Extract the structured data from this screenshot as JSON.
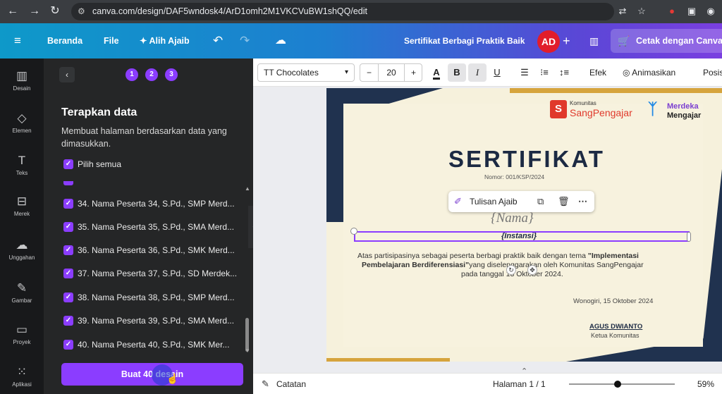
{
  "browser": {
    "url": "canva.com/design/DAF5wndosk4/ArD1omh2M1VKCVuBW1shQQ/edit"
  },
  "topbar": {
    "menu_icon": "hamburger-icon",
    "home": "Beranda",
    "file": "File",
    "magic": "Alih Ajaib",
    "title": "Sertifikat Berbagi Praktik Baik",
    "avatar": "AD",
    "print": "Cetak dengan Canva"
  },
  "rail": {
    "items": [
      {
        "label": "Desain",
        "icon": "layout-icon"
      },
      {
        "label": "Elemen",
        "icon": "shapes-icon"
      },
      {
        "label": "Teks",
        "icon": "text-icon"
      },
      {
        "label": "Merek",
        "icon": "brand-icon"
      },
      {
        "label": "Unggahan",
        "icon": "upload-icon"
      },
      {
        "label": "Gambar",
        "icon": "draw-icon"
      },
      {
        "label": "Proyek",
        "icon": "folder-icon"
      },
      {
        "label": "Aplikasi",
        "icon": "apps-icon"
      }
    ]
  },
  "panel": {
    "steps": [
      "1",
      "2",
      "3"
    ],
    "title": "Terapkan data",
    "description": "Membuat halaman berdasarkan data yang dimasukkan.",
    "select_all": "Pilih semua",
    "rows": [
      "34. Nama Peserta 34, S.Pd., SMP Merd...",
      "35. Nama Peserta 35, S.Pd., SMA Merd...",
      "36. Nama Peserta 36, S.Pd., SMK Merd...",
      "37. Nama Peserta 37, S.Pd., SD Merdek...",
      "38. Nama Peserta 38, S.Pd., SMP Merd...",
      "39. Nama Peserta 39, S.Pd., SMA Merd...",
      "40. Nama Peserta 40, S.Pd., SMK Mer..."
    ],
    "create_button": "Buat 40 desain"
  },
  "toolbar": {
    "font": "TT Chocolates",
    "font_size": "20",
    "minus": "−",
    "plus": "+",
    "bold": "B",
    "italic": "I",
    "underline": "U",
    "effects": "Efek",
    "animate": "Animasikan",
    "position": "Posisi"
  },
  "certificate": {
    "community_small": "Komunitas",
    "community_big": "SangPengajar",
    "merdeka1": "Merdeka",
    "merdeka2": "Mengajar",
    "heading": "SERTIFIKAT",
    "number": "Nomor: 001/KSP/2024",
    "name_placeholder": "{Nama}",
    "institution_placeholder": "{Instansi}",
    "body_line1_pre": "Atas partisipasinya sebagai peserta berbagi praktik baik dengan tema ",
    "body_line1_bold": "\"Implementasi",
    "body_line2_bold": "Pembelajaran Berdiferensiasi\"",
    "body_line2_post": "yang diselenggarakan oleh Komunitas SangPengajar",
    "body_line3": "pada tanggal 13 Oktober 2024.",
    "place_date": "Wonogiri, 15 Oktober 2024",
    "signer": "AGUS DWIANTO",
    "signer_role": "Ketua Komunitas",
    "magic_write": "Tulisan Ajaib"
  },
  "bottombar": {
    "notes": "Catatan",
    "page": "Halaman 1 / 1",
    "zoom": "59%",
    "zoom_level": 0.59
  },
  "colors": {
    "accent": "#8b3dff",
    "navy": "#20324f",
    "gold": "#d6a43d",
    "avatar": "#e11d2b"
  }
}
